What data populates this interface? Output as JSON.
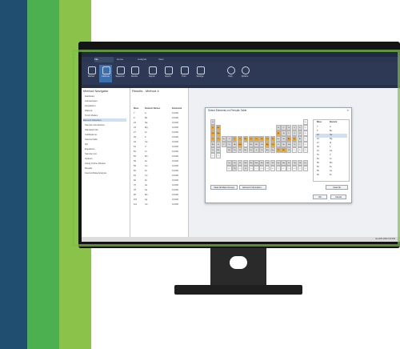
{
  "colors": {
    "stripe_navy": "#1f4e70",
    "stripe_green": "#4caf50",
    "stripe_light_green": "#8bc34a",
    "overlay_green": "#7ac143"
  },
  "ribbon": {
    "tabs": [
      "File",
      "Home",
      "Analysis",
      "View"
    ],
    "buttons": [
      "Method",
      "Calibrate",
      "Sequence",
      "Results",
      "Report",
      "Export",
      "Print",
      "Settings",
      "Help",
      "Options"
    ]
  },
  "navigator": {
    "title": "Method Navigator",
    "items": [
      "Hardware",
      "Autosampler",
      "Acquisition",
      "Plasma",
      "Torch Modes",
      "Element Selection",
      "Sample Introduction",
      "Standard Info",
      "Calibrations",
      "Internal Stds",
      "QC",
      "Equations",
      "Sample List",
      "Options",
      "Using Online Dilution",
      "Results",
      "Internal Data Analysis"
    ]
  },
  "results": {
    "title": "Results - Method 4",
    "columns": [
      "Mass",
      "Element Names",
      "Elemental"
    ],
    "rows": [
      {
        "mass": "7",
        "el": "Li",
        "val": "0.1000"
      },
      {
        "mass": "9",
        "el": "Be",
        "val": "0.1000"
      },
      {
        "mass": "23",
        "el": "Na",
        "val": "0.1000"
      },
      {
        "mass": "24",
        "el": "Mg",
        "val": "0.1000"
      },
      {
        "mass": "27",
        "el": "Al",
        "val": "0.1000"
      },
      {
        "mass": "39",
        "el": "K",
        "val": "0.1000"
      },
      {
        "mass": "44",
        "el": "Ca",
        "val": "0.1000"
      },
      {
        "mass": "51",
        "el": "V",
        "val": "0.1000"
      },
      {
        "mass": "52",
        "el": "Cr",
        "val": "0.1000"
      },
      {
        "mass": "55",
        "el": "Mn",
        "val": "0.1000"
      },
      {
        "mass": "56",
        "el": "Fe",
        "val": "0.1000"
      },
      {
        "mass": "59",
        "el": "Co",
        "val": "0.1000"
      },
      {
        "mass": "60",
        "el": "Ni",
        "val": "0.1000"
      },
      {
        "mass": "63",
        "el": "Cu",
        "val": "0.1000"
      },
      {
        "mass": "66",
        "el": "Zn",
        "val": "0.1000"
      },
      {
        "mass": "75",
        "el": "As",
        "val": "0.1000"
      },
      {
        "mass": "78",
        "el": "Se",
        "val": "0.1000"
      },
      {
        "mass": "95",
        "el": "Mo",
        "val": "0.1000"
      },
      {
        "mass": "107",
        "el": "Ag",
        "val": "0.1000"
      },
      {
        "mass": "111",
        "el": "Cd",
        "val": "0.1000"
      }
    ]
  },
  "dialog": {
    "title": "Select Elements on Periodic Table",
    "close": "×",
    "selected_header": "Selected Elements",
    "selected_cols": [
      "Mass",
      "Element"
    ],
    "selected": [
      {
        "mass": "7",
        "el": "Li"
      },
      {
        "mass": "9",
        "el": "Be"
      },
      {
        "mass": "23",
        "el": "Na"
      },
      {
        "mass": "24",
        "el": "Mg"
      },
      {
        "mass": "27",
        "el": "Al"
      },
      {
        "mass": "39",
        "el": "K"
      },
      {
        "mass": "44",
        "el": "Ca"
      },
      {
        "mass": "51",
        "el": "V"
      },
      {
        "mass": "52",
        "el": "Cr"
      },
      {
        "mass": "55",
        "el": "Mn"
      },
      {
        "mass": "56",
        "el": "Fe"
      },
      {
        "mass": "59",
        "el": "Co"
      },
      {
        "mass": "60",
        "el": "Ni"
      }
    ],
    "clear_all": "Clear All",
    "btn_left": "Clear All Mass Groups",
    "btn_middle": "Element Information...",
    "ok": "OK",
    "cancel": "Cancel"
  },
  "status": {
    "text": "NexION 2000 ICP-MS"
  }
}
